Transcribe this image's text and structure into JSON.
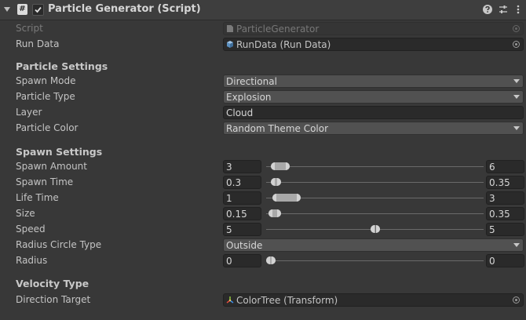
{
  "header": {
    "title": "Particle Generator (Script)",
    "script_icon_glyph": "#",
    "icons": [
      "help-icon",
      "presets-icon",
      "context-menu-icon"
    ]
  },
  "script_row": {
    "label": "Script",
    "value": "ParticleGenerator"
  },
  "run_data_row": {
    "label": "Run Data",
    "value": "RunData (Run Data)"
  },
  "particle_settings": {
    "title": "Particle Settings",
    "spawn_mode": {
      "label": "Spawn Mode",
      "value": "Directional"
    },
    "particle_type": {
      "label": "Particle Type",
      "value": "Explosion"
    },
    "layer": {
      "label": "Layer",
      "value": "Cloud"
    },
    "particle_color": {
      "label": "Particle Color",
      "value": "Random Theme Color"
    }
  },
  "spawn_settings": {
    "title": "Spawn Settings",
    "rows": [
      {
        "key": "spawn_amount",
        "label": "Spawn Amount",
        "min": "3",
        "max": "6",
        "lo_frac": 0.02,
        "hi_frac": 0.11
      },
      {
        "key": "spawn_time",
        "label": "Spawn Time",
        "min": "0.3",
        "max": "0.35",
        "lo_frac": 0.02,
        "hi_frac": 0.07
      },
      {
        "key": "life_time",
        "label": "Life Time",
        "min": "1",
        "max": "3",
        "lo_frac": 0.03,
        "hi_frac": 0.16
      },
      {
        "key": "size",
        "label": "Size",
        "min": "0.15",
        "max": "0.35",
        "lo_frac": 0.01,
        "hi_frac": 0.07
      },
      {
        "key": "speed",
        "label": "Speed",
        "min": "5",
        "max": "5",
        "lo_frac": 0.48,
        "hi_frac": 0.52
      }
    ],
    "radius_circle_type": {
      "label": "Radius Circle Type",
      "value": "Outside"
    },
    "radius": {
      "label": "Radius",
      "min": "0",
      "max": "0",
      "lo_frac": 0.0,
      "hi_frac": 0.045
    }
  },
  "velocity_type": {
    "title": "Velocity Type",
    "direction_target": {
      "label": "Direction Target",
      "value": "ColorTree (Transform)"
    }
  }
}
